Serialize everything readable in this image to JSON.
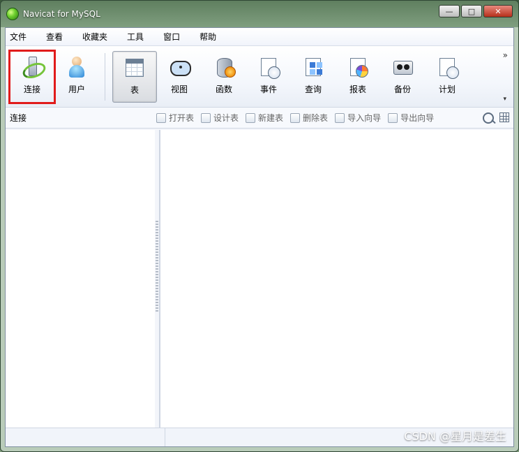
{
  "window": {
    "title": "Navicat for MySQL",
    "controls": [
      "minimize",
      "maximize",
      "close"
    ]
  },
  "menu": [
    "文件",
    "查看",
    "收藏夹",
    "工具",
    "窗口",
    "帮助"
  ],
  "toolbar": {
    "items": [
      {
        "id": "connect",
        "label": "连接",
        "icon": "connect-icon",
        "highlighted": true
      },
      {
        "id": "user",
        "label": "用户",
        "icon": "user-icon"
      },
      {
        "id": "table",
        "label": "表",
        "icon": "table-icon",
        "active": true
      },
      {
        "id": "view",
        "label": "视图",
        "icon": "view-icon"
      },
      {
        "id": "function",
        "label": "函数",
        "icon": "function-icon"
      },
      {
        "id": "event",
        "label": "事件",
        "icon": "event-icon"
      },
      {
        "id": "query",
        "label": "查询",
        "icon": "query-icon"
      },
      {
        "id": "report",
        "label": "报表",
        "icon": "report-icon"
      },
      {
        "id": "backup",
        "label": "备份",
        "icon": "backup-icon"
      },
      {
        "id": "schedule",
        "label": "计划",
        "icon": "schedule-icon"
      }
    ],
    "overflow_glyph": "»",
    "overflow_down": "▾"
  },
  "subbar": {
    "left_label": "连接",
    "actions": [
      "打开表",
      "设计表",
      "新建表",
      "删除表",
      "导入向导",
      "导出向导"
    ]
  },
  "watermark": "CSDN @星月是差生"
}
